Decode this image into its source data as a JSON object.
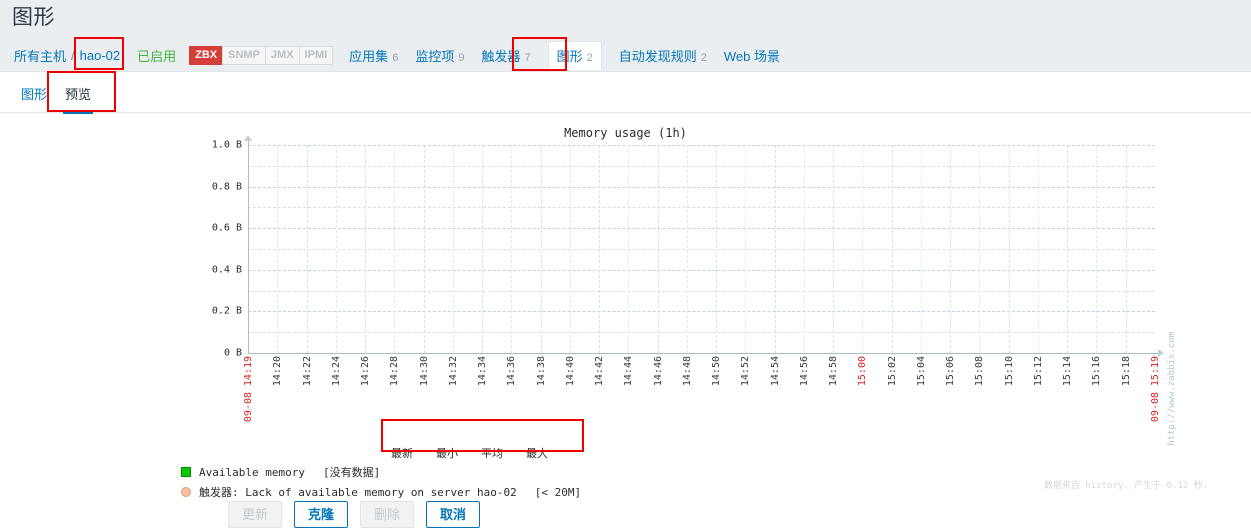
{
  "header": {
    "title": "图形"
  },
  "nav": {
    "breadcrumb_root": "所有主机",
    "breadcrumb_sep": "/",
    "breadcrumb_host": "hao-02",
    "status": "已启用",
    "badges": [
      {
        "label": "ZBX",
        "active": true
      },
      {
        "label": "SNMP",
        "active": false
      },
      {
        "label": "JMX",
        "active": false
      },
      {
        "label": "IPMI",
        "active": false
      }
    ],
    "items": [
      {
        "label": "应用集",
        "count": "6",
        "selected": false
      },
      {
        "label": "监控项",
        "count": "9",
        "selected": false
      },
      {
        "label": "触发器",
        "count": "7",
        "selected": false
      },
      {
        "label": "图形",
        "count": "2",
        "selected": true
      },
      {
        "label": "自动发现规则",
        "count": "2",
        "selected": false
      },
      {
        "label": "Web 场景",
        "count": "",
        "selected": false
      }
    ]
  },
  "subtabs": [
    {
      "label": "图形",
      "active": false
    },
    {
      "label": "预览",
      "active": true
    }
  ],
  "chart_data": {
    "type": "line",
    "title": "Memory usage (1h)",
    "xlabel": "",
    "ylabel": "",
    "ylim": [
      0,
      1.0
    ],
    "y_unit": "B",
    "y_ticks": [
      "1.0 B",
      "0.8 B",
      "0.6 B",
      "0.4 B",
      "0.2 B",
      "0 B"
    ],
    "y_tick_values": [
      1.0,
      0.8,
      0.6,
      0.4,
      0.2,
      0
    ],
    "grid": true,
    "x_start_date": "09-08",
    "x_end_date": "09-08",
    "x_ticks": [
      "14:19",
      "14:20",
      "14:22",
      "14:24",
      "14:26",
      "14:28",
      "14:30",
      "14:32",
      "14:34",
      "14:36",
      "14:38",
      "14:40",
      "14:42",
      "14:44",
      "14:46",
      "14:48",
      "14:50",
      "14:52",
      "14:54",
      "14:56",
      "14:58",
      "15:00",
      "15:02",
      "15:04",
      "15:06",
      "15:08",
      "15:10",
      "15:12",
      "15:14",
      "15:16",
      "15:18",
      "15:19"
    ],
    "x_edge_ticks": [
      "14:19",
      "15:19"
    ],
    "x_highlight_ticks": [
      "15:00"
    ],
    "series": [
      {
        "name": "Available memory",
        "values": [],
        "color": "#00cc00",
        "note": "[没有数据]"
      }
    ],
    "trigger": {
      "prefix": "触发器",
      "name": "Lack of available memory on server hao-02",
      "threshold": "[< 20M]",
      "color": "#fbc0a0"
    },
    "legend_headers": [
      "最新",
      "最小",
      "平均",
      "最大"
    ],
    "watermark": "http://www.zabbix.com"
  },
  "footnote": "数据来自 history. 产生于 0.12 秒.",
  "buttons": [
    {
      "label": "更新",
      "style": "disabled"
    },
    {
      "label": "克隆",
      "style": "primary"
    },
    {
      "label": "删除",
      "style": "disabled"
    },
    {
      "label": "取消",
      "style": "primary"
    }
  ]
}
